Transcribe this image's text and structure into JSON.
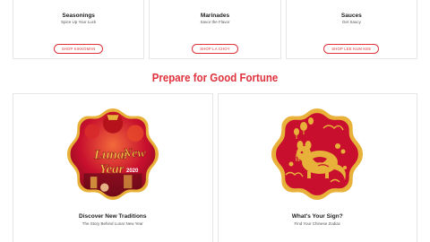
{
  "top_cards": [
    {
      "title": "Seasonings",
      "subtitle": "Spice Up Your Luck",
      "button": "SHOP KIKKOMAN"
    },
    {
      "title": "Marinades",
      "subtitle": "Savor the Flavor",
      "button": "SHOP LA CHOY"
    },
    {
      "title": "Sauces",
      "subtitle": "Get Saucy",
      "button": "SHOP LEE KUM KEE"
    }
  ],
  "section_heading": "Prepare for Good Fortune",
  "bottom_cards": [
    {
      "title": "Discover New Traditions",
      "subtitle": "The Story Behind Lunar New Year",
      "medal_text_line1": "Lunar",
      "medal_text_line2": "New",
      "medal_text_line3": "Year",
      "medal_year": "2020"
    },
    {
      "title": "What's Your Sign?",
      "subtitle": "Find Your Chinese Zodiac",
      "medal_glyph": "鼠"
    }
  ],
  "colors": {
    "accent": "#e0323c",
    "gold": "#e8b23a",
    "deep_red": "#c8102e"
  }
}
